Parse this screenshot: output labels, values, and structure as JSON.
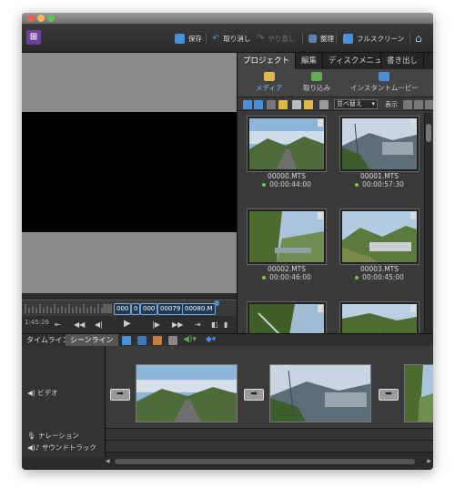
{
  "toolbar": {
    "save_label": "保存",
    "undo_label": "取り消し",
    "redo_label": "やり直し",
    "organize_label": "整理",
    "fullscreen_label": "フルスクリーン"
  },
  "monitor": {
    "timecode": "1:45:26",
    "scrubber_clips": [
      "000",
      "0",
      "000",
      "00079",
      "00080.M"
    ]
  },
  "panel": {
    "tabs": [
      "プロジェクト",
      "編集",
      "ディスクメニュー",
      "書き出し"
    ],
    "subtabs": [
      "メディア",
      "取り込み",
      "インスタントムービー"
    ],
    "sort_label": "並べ替え",
    "view_label": "表示",
    "media": [
      {
        "name": "00000.MTS",
        "duration": "00:00:44:00"
      },
      {
        "name": "00001.MTS",
        "duration": "00:00:57:30"
      },
      {
        "name": "00002.MTS",
        "duration": "00:00:46:00"
      },
      {
        "name": "00003.MTS",
        "duration": "00:00:45:00"
      },
      {
        "name": "",
        "duration": ""
      },
      {
        "name": "",
        "duration": ""
      }
    ]
  },
  "timeline": {
    "tabs": [
      "タイムライン",
      "シーンライン"
    ],
    "tracks": {
      "video": "ビデオ",
      "narration": "ナレーション",
      "soundtrack": "サウンドトラック"
    }
  },
  "colors": {
    "accent": "#4a90d9",
    "app_logo": "#6b3fa0",
    "status_dot": "#6fcf3a"
  }
}
